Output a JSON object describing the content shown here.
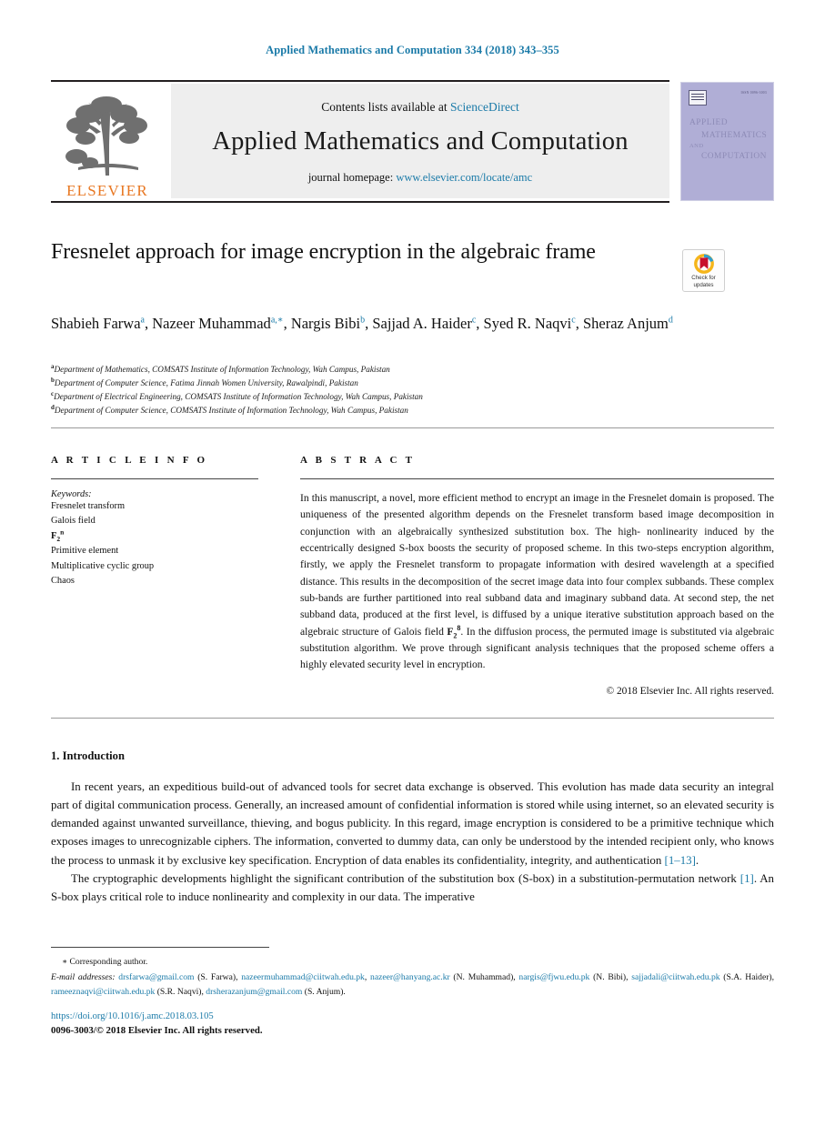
{
  "running_head": "Applied Mathematics and Computation 334 (2018) 343–355",
  "masthead": {
    "contents_prefix": "Contents lists available at ",
    "contents_link": "ScienceDirect",
    "journal_name": "Applied Mathematics and Computation",
    "homepage_prefix": "journal homepage: ",
    "homepage_link": "www.elsevier.com/locate/amc",
    "publisher_wordmark": "ELSEVIER",
    "cover": {
      "line1": "APPLIED",
      "line2": "MATHEMATICS",
      "line3": "AND",
      "line4": "COMPUTATION",
      "issn": "ISSN 0096-3003"
    }
  },
  "article": {
    "title": "Fresnelet approach for image encryption in the algebraic frame",
    "crossmark_label_line1": "Check for",
    "crossmark_label_line2": "updates",
    "authors": [
      {
        "name": "Shabieh Farwa",
        "marks": "a",
        "star": false
      },
      {
        "name": "Nazeer Muhammad",
        "marks": "a",
        "star": true
      },
      {
        "name": "Nargis Bibi",
        "marks": "b",
        "star": false
      },
      {
        "name": "Sajjad A. Haider",
        "marks": "c",
        "star": false
      },
      {
        "name": "Syed R. Naqvi",
        "marks": "c",
        "star": false
      },
      {
        "name": "Sheraz Anjum",
        "marks": "d",
        "star": false
      }
    ],
    "affiliations": [
      {
        "mark": "a",
        "text": "Department of Mathematics, COMSATS Institute of Information Technology, Wah Campus, Pakistan"
      },
      {
        "mark": "b",
        "text": "Department of Computer Science, Fatima Jinnah Women University, Rawalpindi, Pakistan"
      },
      {
        "mark": "c",
        "text": "Department of Electrical Engineering, COMSATS Institute of Information Technology, Wah Campus, Pakistan"
      },
      {
        "mark": "d",
        "text": "Department of Computer Science, COMSATS Institute of Information Technology, Wah Campus, Pakistan"
      }
    ]
  },
  "article_info": {
    "heading": "A R T I C L E    I N F O",
    "keywords_label": "Keywords:",
    "keywords": [
      "Fresnelet transform",
      "Galois field",
      "F2n",
      "Primitive element",
      "Multiplicative cyclic group",
      "Chaos"
    ]
  },
  "abstract": {
    "heading": "A B S T R A C T",
    "part1": "In this manuscript, a novel, more efficient method to encrypt an image in the Fresnelet domain is proposed. The uniqueness of the presented algorithm depends on the Fresnelet transform based image decomposition in conjunction with an algebraically synthesized substitution box. The high- nonlinearity induced by the eccentrically designed S-box boosts the security of proposed scheme. In this two-steps encryption algorithm, firstly, we apply the Fresnelet transform to propagate information with desired wavelength at a specified distance. This results in the decomposition of the secret image data into four complex subbands. These complex sub-bands are further partitioned into real subband data and imaginary subband data. At second step, the net subband data, produced at the first level, is diffused by a unique iterative substitution approach based on the algebraic structure of Galois field ",
    "field_symbol": "F",
    "field_sub": "2",
    "field_sup": "8",
    "part2": ". In the diffusion process, the permuted image is substituted via algebraic substitution algorithm. We prove through significant analysis techniques that the proposed scheme offers a highly elevated security level in encryption.",
    "copyright": "© 2018 Elsevier Inc. All rights reserved."
  },
  "body": {
    "heading": "1. Introduction",
    "paragraph1": "In recent years, an expeditious build-out of advanced tools for secret data exchange is observed. This evolution has made data security an integral part of digital communication process. Generally, an increased amount of confidential information is stored while using internet, so an elevated security is demanded against unwanted surveillance, thieving, and bogus publicity. In this regard, image encryption is considered to be a primitive technique which exposes images to unrecognizable ciphers. The information, converted to dummy data, can only be understood by the intended recipient only, who knows the process to unmask it by exclusive key specification. Encryption of data enables its confidentiality, integrity, and authentication ",
    "paragraph1_ref": "[1–13]",
    "paragraph1_end": ".",
    "paragraph2_a": "The cryptographic developments highlight the significant contribution of the substitution box (S-box) in a substitution-permutation network ",
    "paragraph2_ref": "[1]",
    "paragraph2_b": ". An S-box plays critical role to induce nonlinearity and complexity in our data. The imperative"
  },
  "footer": {
    "corresponding_star": "∗",
    "corresponding_text": " Corresponding author.",
    "emails_label": "E-mail addresses:",
    "emails": [
      {
        "address": "drsfarwa@gmail.com",
        "owner": "(S. Farwa)",
        "sep": ", "
      },
      {
        "address": "nazeermuhammad@ciitwah.edu.pk",
        "owner": "",
        "sep": ", "
      },
      {
        "address": "nazeer@hanyang.ac.kr",
        "owner": "(N. Muhammad)",
        "sep": ", "
      },
      {
        "address": "nargis@fjwu.edu.pk",
        "owner": "(N. Bibi)",
        "sep": ", "
      },
      {
        "address": "sajjadali@ciitwah.edu.pk",
        "owner": "(S.A. Haider)",
        "sep": ", "
      },
      {
        "address": "rameeznaqvi@ciitwah.edu.pk",
        "owner": "(S.R. Naqvi)",
        "sep": ", "
      },
      {
        "address": "drsherazanjum@gmail.com",
        "owner": "(S. Anjum)",
        "sep": "."
      }
    ],
    "doi": "https://doi.org/10.1016/j.amc.2018.03.105",
    "issn_line": "0096-3003/© 2018 Elsevier Inc. All rights reserved."
  },
  "colors": {
    "link": "#1a7aa8",
    "elsevier_orange": "#e87722",
    "cover_purple": "#b0aed6",
    "band_gray": "#eeeeee"
  }
}
